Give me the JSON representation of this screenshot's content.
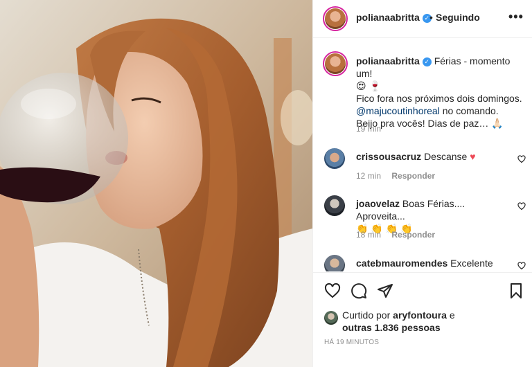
{
  "post": {
    "username": "polianaabritta",
    "follow_status": "Seguindo",
    "caption": {
      "line1": "Férias - momento um!",
      "emojis": "😍 🍷",
      "line2": "Fico fora nos próximos dois domingos.",
      "mention": "@majucoutinhoreal",
      "line3": "no comando.",
      "line4": "Beijo pra vocês! Dias de paz…",
      "line4_emoji": "🙏🏻",
      "time": "19 min"
    }
  },
  "comments": [
    {
      "username": "crissousacruz",
      "text": "Descanse",
      "emoji": "♥",
      "time": "12 min",
      "reply": "Responder"
    },
    {
      "username": "joaovelaz",
      "text": "Boas Férias.... Aproveita...",
      "emoji_line": "👏 👏 👏 👏",
      "time": "18 min",
      "reply": "Responder"
    },
    {
      "username": "catebmauromendes",
      "text": "Excelente"
    }
  ],
  "likes": {
    "prefix": "Curtido por",
    "liker": "aryfontoura",
    "suffix": "e",
    "others": "outras 1.836 pessoas"
  },
  "posted_ago": "HÁ 19 MINUTOS",
  "icons": {
    "more": "more-options-icon",
    "like": "heart-icon",
    "comment": "comment-icon",
    "share": "share-icon",
    "save": "bookmark-icon"
  },
  "colors": {
    "verified": "#3897f0",
    "heart_red": "#ed4956",
    "mention": "#00376b",
    "muted": "#8e8e8e"
  }
}
